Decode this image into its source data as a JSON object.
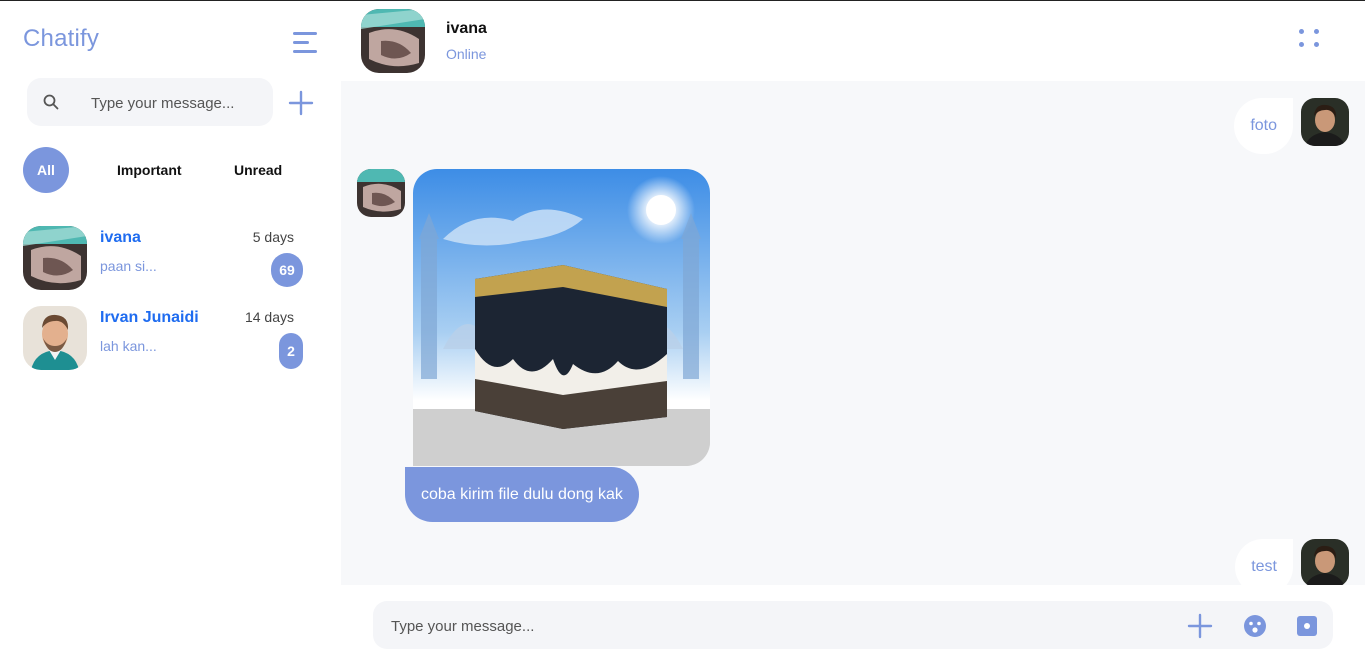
{
  "sidebar": {
    "brand": "Chatify",
    "search": {
      "placeholder": "Type your message..."
    },
    "tabs": {
      "all": "All",
      "important": "Important",
      "unread": "Unread"
    },
    "contacts": [
      {
        "name": "ivana",
        "preview": "paan si...",
        "time": "5 days",
        "unread": "69"
      },
      {
        "name": "Irvan Junaidi",
        "preview": "lah kan...",
        "time": "14 days",
        "unread": "2"
      }
    ]
  },
  "header": {
    "name": "ivana",
    "status": "Online"
  },
  "messages": {
    "sent_1": "foto",
    "received_text": "coba kirim file dulu dong kak",
    "sent_2": "test"
  },
  "composer": {
    "placeholder": "Type your message..."
  },
  "colors": {
    "accent": "#7b96dd",
    "link": "#1f6cf0",
    "chat_bg": "#f7f8fa"
  },
  "icons": [
    "menu-icon",
    "search-icon",
    "plus-icon",
    "more-dots-icon",
    "emoji-icon",
    "image-icon"
  ]
}
